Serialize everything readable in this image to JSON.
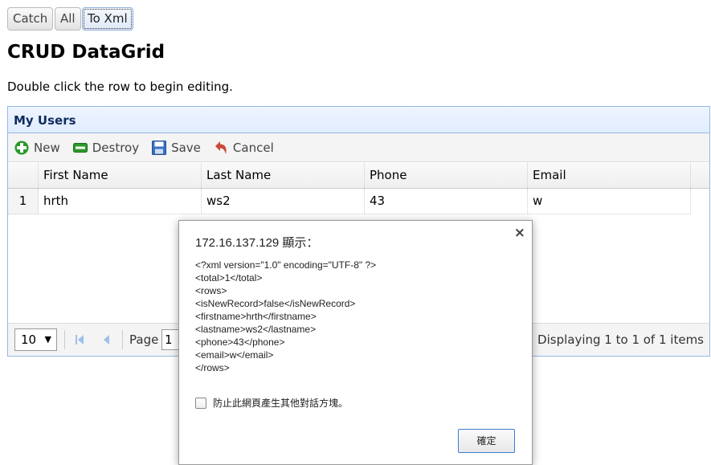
{
  "top_buttons": {
    "catch_label": "Catch",
    "all_label": "All",
    "toxml_label": "To Xml"
  },
  "page_title": "CRUD DataGrid",
  "intro_text": "Double click the row to begin editing.",
  "panel": {
    "title": "My Users"
  },
  "toolbar": {
    "new_label": "New",
    "destroy_label": "Destroy",
    "save_label": "Save",
    "cancel_label": "Cancel"
  },
  "columns": [
    "First Name",
    "Last Name",
    "Phone",
    "Email"
  ],
  "rows": [
    {
      "num": "1",
      "firstname": "hrth",
      "lastname": "ws2",
      "phone": "43",
      "email": "w"
    }
  ],
  "pager": {
    "page_size": "10",
    "page_label": "Page",
    "page_value": "1",
    "info": "Displaying 1 to 1 of 1 items"
  },
  "dialog": {
    "title": "172.16.137.129 顯示：",
    "lines": [
      "<?xml version=\"1.0\" encoding=\"UTF-8\" ?>",
      "<total>1</total>",
      "<rows>",
      "<isNewRecord>false</isNewRecord>",
      "<firstname>hrth</firstname>",
      "<lastname>ws2</lastname>",
      "<phone>43</phone>",
      "<email>w</email>",
      "</rows>"
    ],
    "checkbox_label": "防止此網頁產生其他對話方塊。",
    "ok_label": "確定",
    "close_symbol": "×"
  },
  "colors": {
    "panel_border": "#95b8e7",
    "panel_header": "#e0ecff",
    "new_icon": "#2a9a2a",
    "save_icon": "#3a6fc4",
    "cancel_icon": "#c84a3a"
  }
}
